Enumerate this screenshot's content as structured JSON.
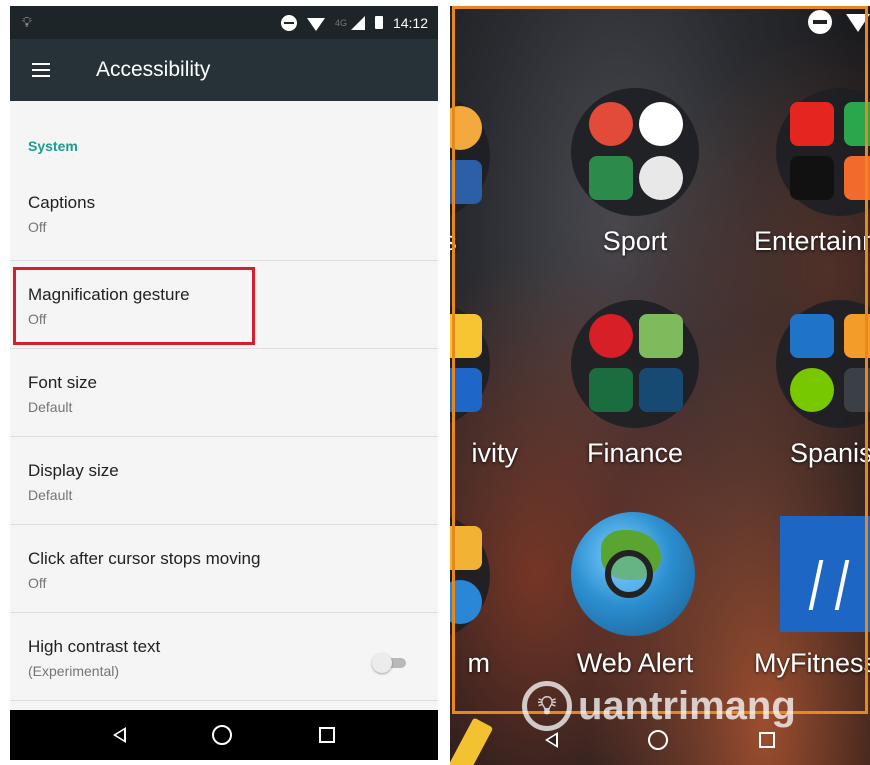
{
  "status_bar": {
    "network_type": "4G",
    "time": "14:12"
  },
  "app_bar": {
    "title": "Accessibility"
  },
  "settings": {
    "section_header": "System",
    "items": [
      {
        "title": "Captions",
        "summary": "Off"
      },
      {
        "title": "Magnification gesture",
        "summary": "Off",
        "highlighted": true
      },
      {
        "title": "Font size",
        "summary": "Default"
      },
      {
        "title": "Display size",
        "summary": "Default"
      },
      {
        "title": "Click after cursor stops moving",
        "summary": "Off"
      },
      {
        "title": "High contrast text",
        "summary": "(Experimental)",
        "toggle_on": false
      }
    ]
  },
  "home_screen": {
    "folders": [
      {
        "label": "s"
      },
      {
        "label": "Sport"
      },
      {
        "label": "Entertainm"
      },
      {
        "label": "ivity"
      },
      {
        "label": "Finance"
      },
      {
        "label": "Spanis"
      },
      {
        "label": "m"
      },
      {
        "label": "Web Alert"
      },
      {
        "label": "MyFitness"
      }
    ],
    "watermark": "uantrimang",
    "frame_color": "#e8871e"
  },
  "colors": {
    "accent_teal": "#1a9e8f",
    "highlight_red": "#d32031",
    "app_bar": "#263238"
  }
}
